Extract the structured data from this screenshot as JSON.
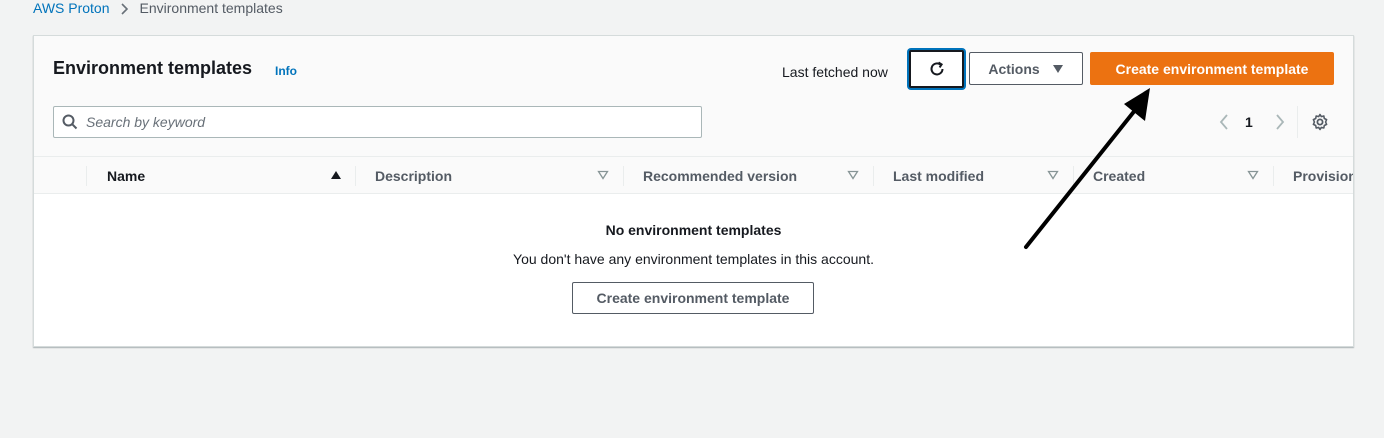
{
  "breadcrumb": {
    "items": [
      "AWS Proton",
      "Environment templates"
    ]
  },
  "header": {
    "title": "Environment templates",
    "info_label": "Info",
    "last_fetched": "Last fetched now",
    "actions_label": "Actions",
    "create_label": "Create environment template"
  },
  "search": {
    "placeholder": "Search by keyword",
    "value": ""
  },
  "pagination": {
    "current_page": "1"
  },
  "table": {
    "columns": [
      {
        "label": "Name",
        "sort": "ascending"
      },
      {
        "label": "Description",
        "sort": "none"
      },
      {
        "label": "Recommended version",
        "sort": "none"
      },
      {
        "label": "Last modified",
        "sort": "none"
      },
      {
        "label": "Created",
        "sort": "none"
      },
      {
        "label": "Provision",
        "sort": "none"
      }
    ]
  },
  "empty_state": {
    "title": "No environment templates",
    "description": "You don't have any environment templates in this account.",
    "button_label": "Create environment template"
  },
  "colors": {
    "primary_button": "#ec7211",
    "link": "#0073bb",
    "focus_ring": "#0073bb",
    "annotation_arrow": "#000000"
  },
  "icons": [
    "chevron-right-icon",
    "refresh-icon",
    "caret-down-icon",
    "search-icon",
    "chevron-left-icon",
    "chevron-right-icon",
    "gear-icon",
    "sort-ascending-icon",
    "sort-none-icon"
  ]
}
